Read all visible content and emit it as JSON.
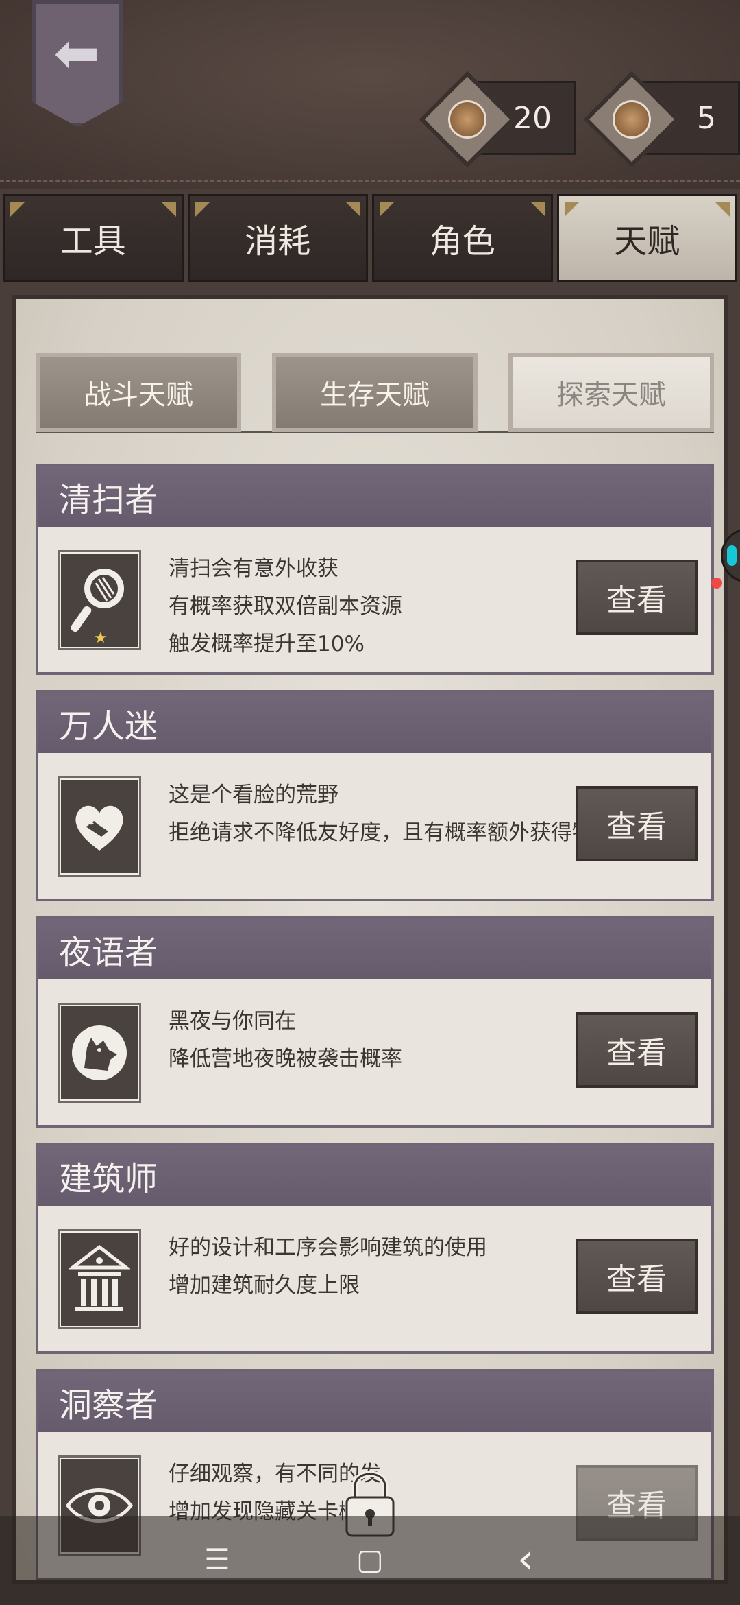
{
  "header": {
    "currencies": [
      {
        "icon": "eagle-coin-icon",
        "value": "20"
      },
      {
        "icon": "horse-coin-icon",
        "value": "5"
      }
    ]
  },
  "tabs": [
    {
      "label": "工具",
      "active": false
    },
    {
      "label": "消耗",
      "active": false
    },
    {
      "label": "角色",
      "active": false
    },
    {
      "label": "天赋",
      "active": true
    }
  ],
  "subtabs": [
    {
      "label": "战斗天赋",
      "active": false
    },
    {
      "label": "生存天赋",
      "active": false
    },
    {
      "label": "探索天赋",
      "active": true
    }
  ],
  "talents": [
    {
      "title": "清扫者",
      "icon": "magnifier-icon",
      "lines": [
        "清扫会有意外收获",
        "有概率获取双倍副本资源",
        "触发概率提升至10%"
      ],
      "button": "查看",
      "locked": false
    },
    {
      "title": "万人迷",
      "icon": "handshake-heart-icon",
      "lines": [
        "这是个看脸的荒野",
        "拒绝请求不降低友好度，且有概率额外获得物"
      ],
      "button": "查看",
      "locked": false
    },
    {
      "title": "夜语者",
      "icon": "wolf-moon-icon",
      "lines": [
        "黑夜与你同在",
        "降低营地夜晚被袭击概率"
      ],
      "button": "查看",
      "locked": false
    },
    {
      "title": "建筑师",
      "icon": "building-icon",
      "lines": [
        "好的设计和工序会影响建筑的使用",
        "增加建筑耐久度上限"
      ],
      "button": "查看",
      "locked": false
    },
    {
      "title": "洞察者",
      "icon": "eye-icon",
      "lines": [
        "仔细观察，有不同的发",
        "增加发现隐藏关卡概"
      ],
      "button": "查看",
      "locked": true
    }
  ],
  "navbar": {
    "menu": "☰",
    "home": "▢",
    "back": "‹"
  }
}
